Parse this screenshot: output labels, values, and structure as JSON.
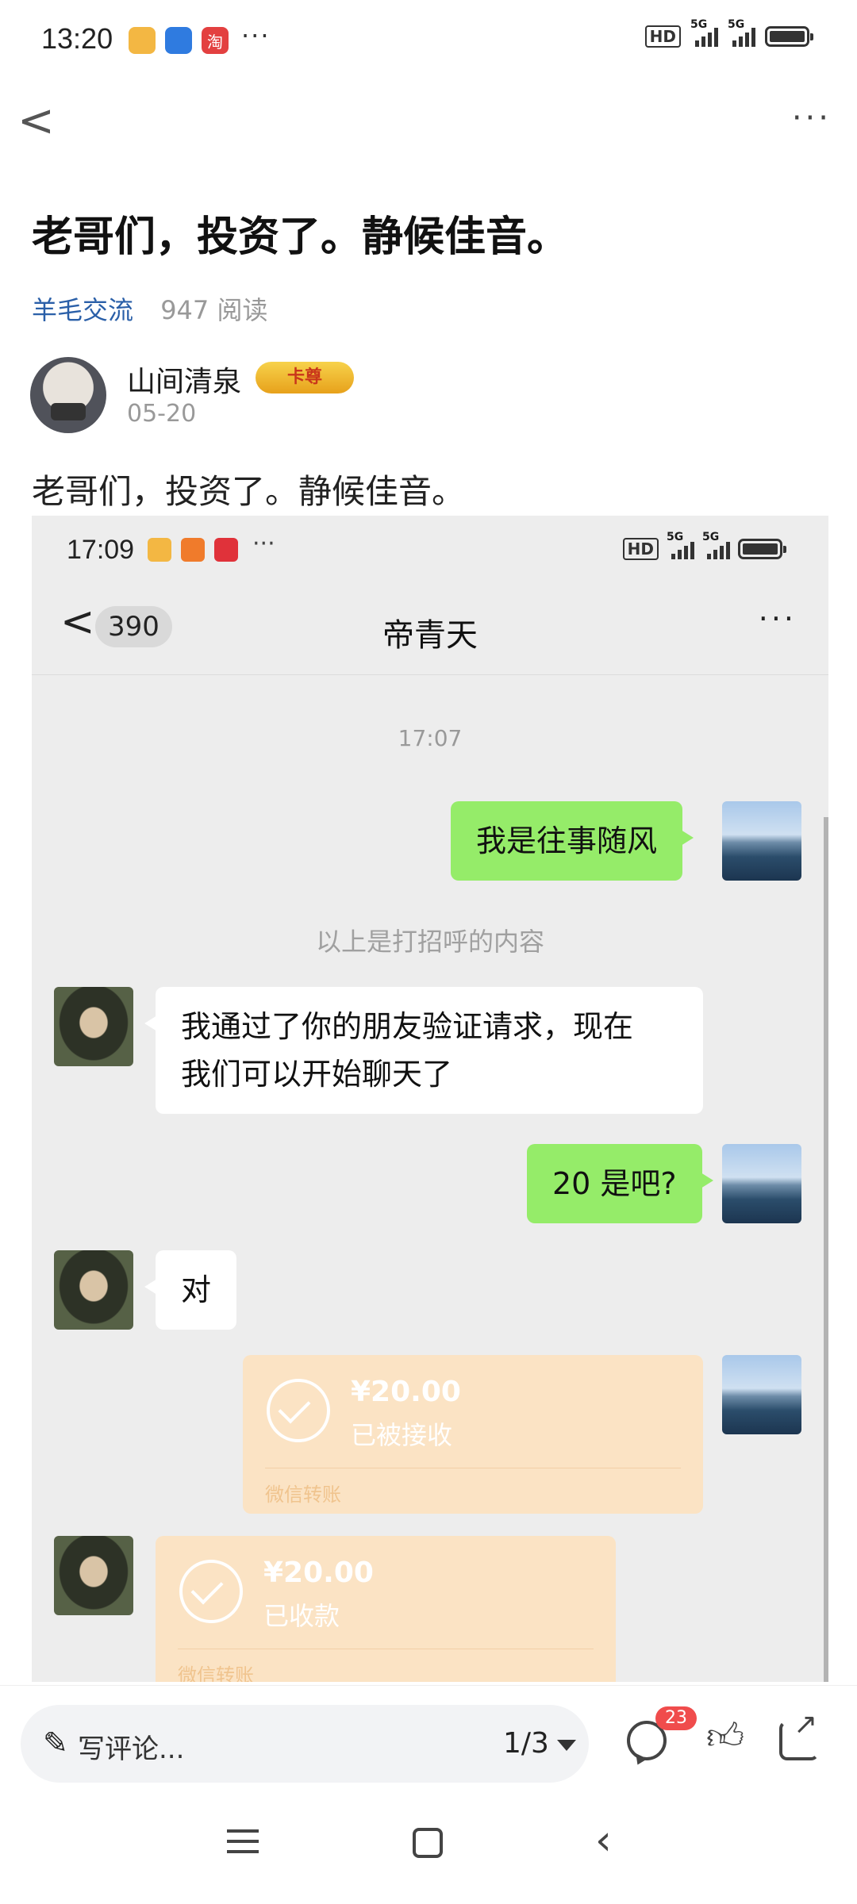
{
  "status_bar": {
    "time": "13:20",
    "more": "···",
    "network_label": "HD",
    "signal_label": "5G",
    "signal_label_2": "5G",
    "icons": [
      "notes-app-icon",
      "files-app-icon",
      "taobao-app-icon",
      "battery-icon"
    ]
  },
  "header": {
    "back": "<",
    "more": "···"
  },
  "post": {
    "title": "老哥们，投资了。静候佳音。",
    "category": "羊毛交流",
    "reads": "947 阅读",
    "author": "山间清泉",
    "badge": "卡尊",
    "date": "05-20",
    "body": "老哥们，投资了。静候佳音。"
  },
  "screenshot": {
    "status": {
      "time": "17:09",
      "more": "···",
      "hd": "HD",
      "sig1": "5G",
      "sig2": "5G"
    },
    "chat_header": {
      "back": "<",
      "unread": "390",
      "contact": "帝青天",
      "more": "···"
    },
    "messages": {
      "time": "17:07",
      "m1": "我是往事随风",
      "hint": "以上是打招呼的内容",
      "m2_line1": "我通过了你的朋友验证请求，现在",
      "m2_line2": "我们可以开始聊天了",
      "m3": "20 是吧?",
      "m4": "对",
      "transfer1": {
        "amount": "¥20.00",
        "status": "已被接收",
        "source": "微信转账"
      },
      "transfer2": {
        "amount": "¥20.00",
        "status": "已收款",
        "source": "微信转账"
      }
    }
  },
  "bottom_bar": {
    "comment_placeholder": "写评论...",
    "pager": "1/3",
    "comment_count": "23"
  },
  "colors": {
    "link": "#2a5fa8",
    "chat_green": "#95ec69",
    "transfer_bg": "#fbe3c4",
    "badge_red": "#f04c4c"
  }
}
